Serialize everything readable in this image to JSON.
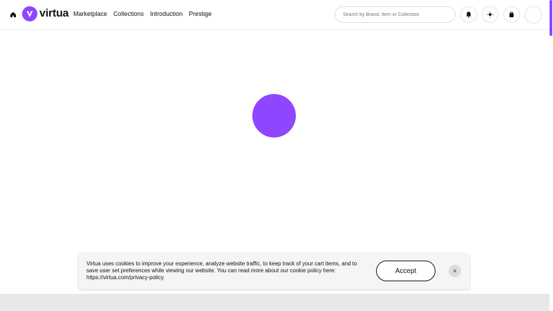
{
  "brand": {
    "name": "virtua",
    "accent_color": "#8c47ff"
  },
  "header": {
    "nav": [
      {
        "label": "Marketplace"
      },
      {
        "label": "Collections"
      },
      {
        "label": "Introduction"
      },
      {
        "label": "Prestige"
      }
    ],
    "search": {
      "placeholder": "Search by Brand, Item or Collection"
    },
    "icons": [
      "home-icon",
      "bell-icon",
      "sun-icon",
      "shopping-bag-icon",
      "user-avatar"
    ]
  },
  "loader": {
    "state": "loading",
    "color": "#9046ff"
  },
  "cookie_banner": {
    "message": "Virtua uses cookies to improve your experience, analyze website traffic, to keep track of your cart items, and to save user set preferences while viewing our website. You can read more about our cookie policy here: https://virtua.com/privacy-policy.",
    "accept_label": "Accept",
    "close_label": "×"
  }
}
